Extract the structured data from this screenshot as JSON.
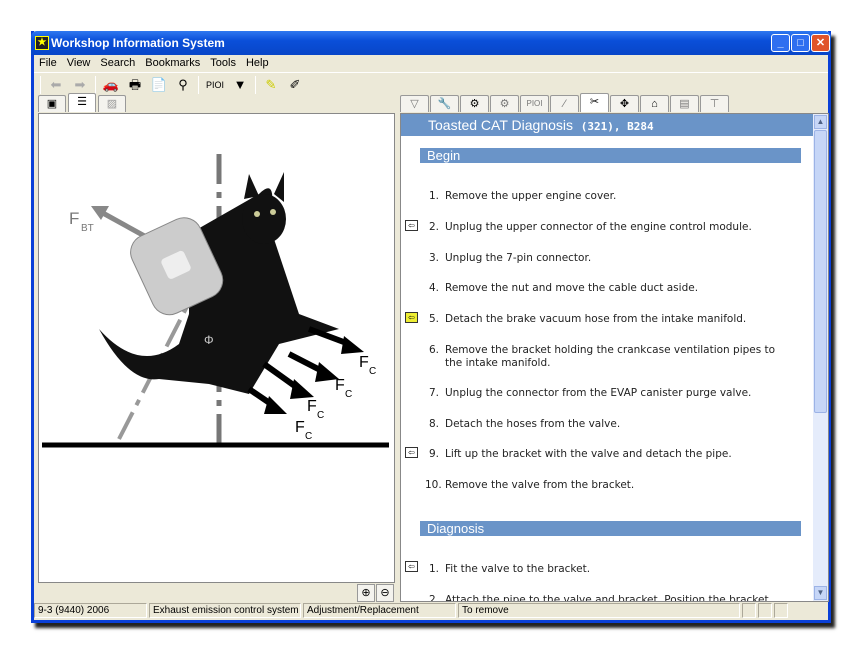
{
  "window": {
    "title": "Workshop Information System"
  },
  "menu": [
    "File",
    "View",
    "Search",
    "Bookmarks",
    "Tools",
    "Help"
  ],
  "toolbar": {
    "pioi_label": "PIOI"
  },
  "right_tabs": {
    "pioi_label": "PIOI"
  },
  "illustration": {
    "label_bt": "F",
    "label_bt_sub": "BT",
    "label_c": "F",
    "label_c_sub": "C",
    "label_phi": "Φ"
  },
  "document": {
    "title": "Toasted CAT Diagnosis",
    "code": "(321), B284",
    "sections": [
      {
        "title": "Begin",
        "steps": [
          {
            "n": "1.",
            "text": "Remove the upper engine cover."
          },
          {
            "n": "2.",
            "text": "Unplug the upper connector of the engine control module."
          },
          {
            "n": "3.",
            "text": "Unplug the 7-pin connector."
          },
          {
            "n": "4.",
            "text": "Remove the nut and move the cable duct aside."
          },
          {
            "n": "5.",
            "text": "Detach the brake vacuum hose from the intake manifold."
          },
          {
            "n": "6.",
            "text": "Remove the bracket holding the crankcase ventilation pipes to the intake manifold."
          },
          {
            "n": "7.",
            "text": "Unplug the connector from the EVAP canister purge valve."
          },
          {
            "n": "8.",
            "text": "Detach the hoses from the valve."
          },
          {
            "n": "9.",
            "text": "Lift up the bracket with the valve and detach the pipe."
          },
          {
            "n": "10.",
            "text": "Remove the valve from the bracket."
          }
        ]
      },
      {
        "title": "Diagnosis",
        "steps": [
          {
            "n": "1.",
            "text": "Fit the valve to the bracket."
          },
          {
            "n": "2.",
            "text": "Attach the pipe to the valve and bracket. Position the bracket"
          }
        ]
      }
    ]
  },
  "status": {
    "vehicle": "9-3 (9440) 2006",
    "system": "Exhaust emission control system",
    "operation": "Adjustment/Replacement",
    "stage": "To remove"
  },
  "colors": {
    "section": "#6a94c8",
    "titlebar": "#0a4fd9"
  }
}
